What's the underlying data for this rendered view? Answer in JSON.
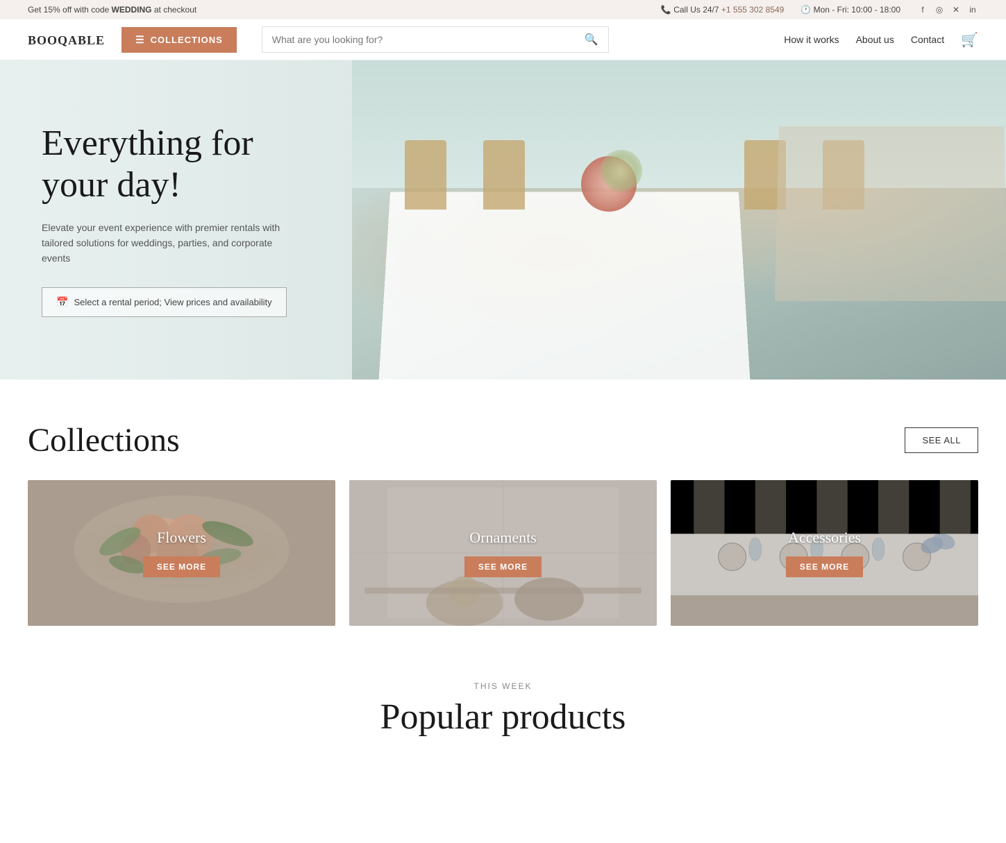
{
  "topbar": {
    "promo_text": "Get 15% off with code ",
    "promo_code": "WEDDING",
    "promo_suffix": " at checkout",
    "phone_label": "Call Us 24/7 ",
    "phone_number": "+1 555 302 8549",
    "hours": "Mon - Fri: 10:00 - 18:00",
    "socials": [
      "facebook",
      "instagram",
      "twitter-x",
      "linkedin"
    ]
  },
  "navbar": {
    "logo": "BOOQABLE",
    "collections_btn": "COLLECTIONS",
    "search_placeholder": "What are you looking for?",
    "nav_links": [
      "How it works",
      "About us",
      "Contact"
    ]
  },
  "hero": {
    "title": "Everything for your day!",
    "subtitle": "Elevate your event experience with premier rentals with tailored solutions for weddings, parties, and corporate events",
    "cta": "Select a rental period; View prices and availability"
  },
  "collections": {
    "section_title": "Collections",
    "see_all_label": "SEE ALL",
    "items": [
      {
        "name": "Flowers",
        "see_more": "SEE MORE",
        "bg_class": "card-flowers"
      },
      {
        "name": "Ornaments",
        "see_more": "SEE MORE",
        "bg_class": "card-ornaments"
      },
      {
        "name": "Accessories",
        "see_more": "SEE MORE",
        "bg_class": "card-accessories"
      }
    ]
  },
  "this_week": {
    "label": "THIS WEEK",
    "title": "Popular products"
  }
}
